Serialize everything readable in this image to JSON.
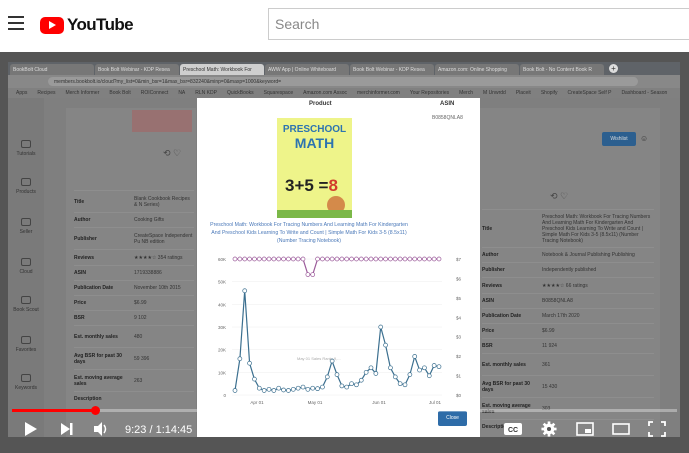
{
  "youtube": {
    "logo_text": "YouTube",
    "search_placeholder": "Search"
  },
  "browser": {
    "tabs": [
      "BookBolt Cloud",
      "Book Bolt Webinar - KDP Resea",
      "Preschool Math: Workbook For",
      "AWW App | Online Whiteboard",
      "Book Bolt Webinar - KDP Resea",
      "Amazon.com: Online Shopping",
      "Book Bolt - No Content Book R"
    ],
    "url": "members.bookbolt.io/cloud?my_list=0&min_bsr=1&max_bsr=832240&minp=0&maxp=1000&keyword=",
    "bookmarks": [
      "Apps",
      "Recipes",
      "Merch Informer",
      "Book Bolt",
      "ROIConnect",
      "NA",
      "RLN KDP",
      "QuickBooks",
      "Squarespace",
      "Amazon.com Assoc",
      "merchinformer.com",
      "Your Repositories",
      "Merch",
      "M Unwrdd",
      "Placeit",
      "Shopify",
      "CreateSpace Self P",
      "Dashboard - Season"
    ]
  },
  "sidebar": {
    "items": [
      "Tutorials",
      "Products",
      "Seller",
      "Cloud",
      "Book Scout",
      "Favorites",
      "Keywords"
    ]
  },
  "left_card": {
    "rows": [
      {
        "k": "Title",
        "v": "Blank Cookbook Recipes & N Series)"
      },
      {
        "k": "Author",
        "v": "Cooking Gifts"
      },
      {
        "k": "Publisher",
        "v": "CreateSpace Independent Pu NB edition"
      },
      {
        "k": "Reviews",
        "v": "★★★★☆ 354 ratings"
      },
      {
        "k": "ASIN",
        "v": "1719338886"
      },
      {
        "k": "Publication Date",
        "v": "November 10th 2015"
      },
      {
        "k": "Price",
        "v": "$6.99"
      },
      {
        "k": "BSR",
        "v": "9 102"
      },
      {
        "k": "Est. monthly sales",
        "v": "480"
      },
      {
        "k": "Avg BSR for past 30 days",
        "v": "59 396"
      },
      {
        "k": "Est. moving average sales",
        "v": "263"
      },
      {
        "k": "Description",
        "v": ""
      }
    ]
  },
  "right_card": {
    "wishlist_label": "Wishlist",
    "rows": [
      {
        "k": "Title",
        "v": "Preschool Math: Workbook For Tracing Numbers And Learning Math For Kindergarten And Preschool Kids Learning To Write and Count | Simple Math For Kids 3-5 (8.5x11) (Number Tracing Notebook)"
      },
      {
        "k": "Author",
        "v": "Notebook & Journal Publishing Publishing"
      },
      {
        "k": "Publisher",
        "v": "Independently published"
      },
      {
        "k": "Reviews",
        "v": "★★★★☆ 66 ratings"
      },
      {
        "k": "ASIN",
        "v": "B0858QNLA8"
      },
      {
        "k": "Publication Date",
        "v": "March 17th 2020"
      },
      {
        "k": "Price",
        "v": "$6.99"
      },
      {
        "k": "BSR",
        "v": "11 924"
      },
      {
        "k": "Est. monthly sales",
        "v": "361"
      },
      {
        "k": "Avg BSR for past 30 days",
        "v": "15 430"
      },
      {
        "k": "Est. moving average sales",
        "v": "303"
      },
      {
        "k": "Description",
        "v": ""
      }
    ]
  },
  "modal": {
    "product_header": "Product",
    "asn_header": "ASIN",
    "asin": "B0858QNLA8",
    "cover_title_1": "PRESCHOOL",
    "cover_title_2": "MATH",
    "cover_equation_left": "3+5 =",
    "cover_equation_right": "8",
    "link_text": "Preschool Math: Workbook For Tracing Numbers And Learning Math For Kindergarten And Preschool Kids Learning To Write and Count | Simple Math For Kids 3-5 (8.5x11) (Number Tracing Notebook)",
    "close_label": "Close"
  },
  "chart_data": {
    "type": "line",
    "x_tick_labels": [
      "Apr 01",
      "May 01",
      "Jun 01",
      "Jul 01"
    ],
    "y_left_ticks": [
      "0",
      "10K",
      "20K",
      "30K",
      "40K",
      "50K",
      "60K"
    ],
    "y_right_ticks": [
      "$0",
      "$1",
      "$2",
      "$3",
      "$4",
      "$5",
      "$6",
      "$7"
    ],
    "ylim_left": [
      0,
      60000
    ],
    "ylim_right": [
      0,
      7
    ],
    "series": [
      {
        "color": "#3b6f8f",
        "axis": "left",
        "values": [
          2000,
          16000,
          46000,
          14000,
          7000,
          3000,
          2000,
          2500,
          2000,
          3000,
          2200,
          2000,
          2500,
          3000,
          3500,
          2500,
          3000,
          2800,
          3500,
          8000,
          15000,
          9000,
          4000,
          3500,
          5000,
          4500,
          6500,
          10000,
          12000,
          9500,
          30000,
          22000,
          12000,
          8000,
          5000,
          4500,
          9000,
          17000,
          11000,
          12000,
          8500,
          13000,
          12500
        ]
      },
      {
        "color": "#9b5a9a",
        "axis": "right",
        "values": [
          7,
          7,
          7,
          7,
          7,
          7,
          7,
          7,
          7,
          7,
          7,
          7,
          7,
          7,
          7,
          6.2,
          6.2,
          7,
          7,
          7,
          7,
          7,
          7,
          7,
          7,
          7,
          7,
          7,
          7,
          7,
          7,
          7,
          7,
          7,
          7,
          7,
          7,
          7,
          7,
          7,
          7,
          7,
          7
        ]
      }
    ],
    "annotation": "May 01 Sales Rank: 9,..."
  },
  "player": {
    "time": "9:23 / 1:14:45",
    "progress": 0.125
  }
}
